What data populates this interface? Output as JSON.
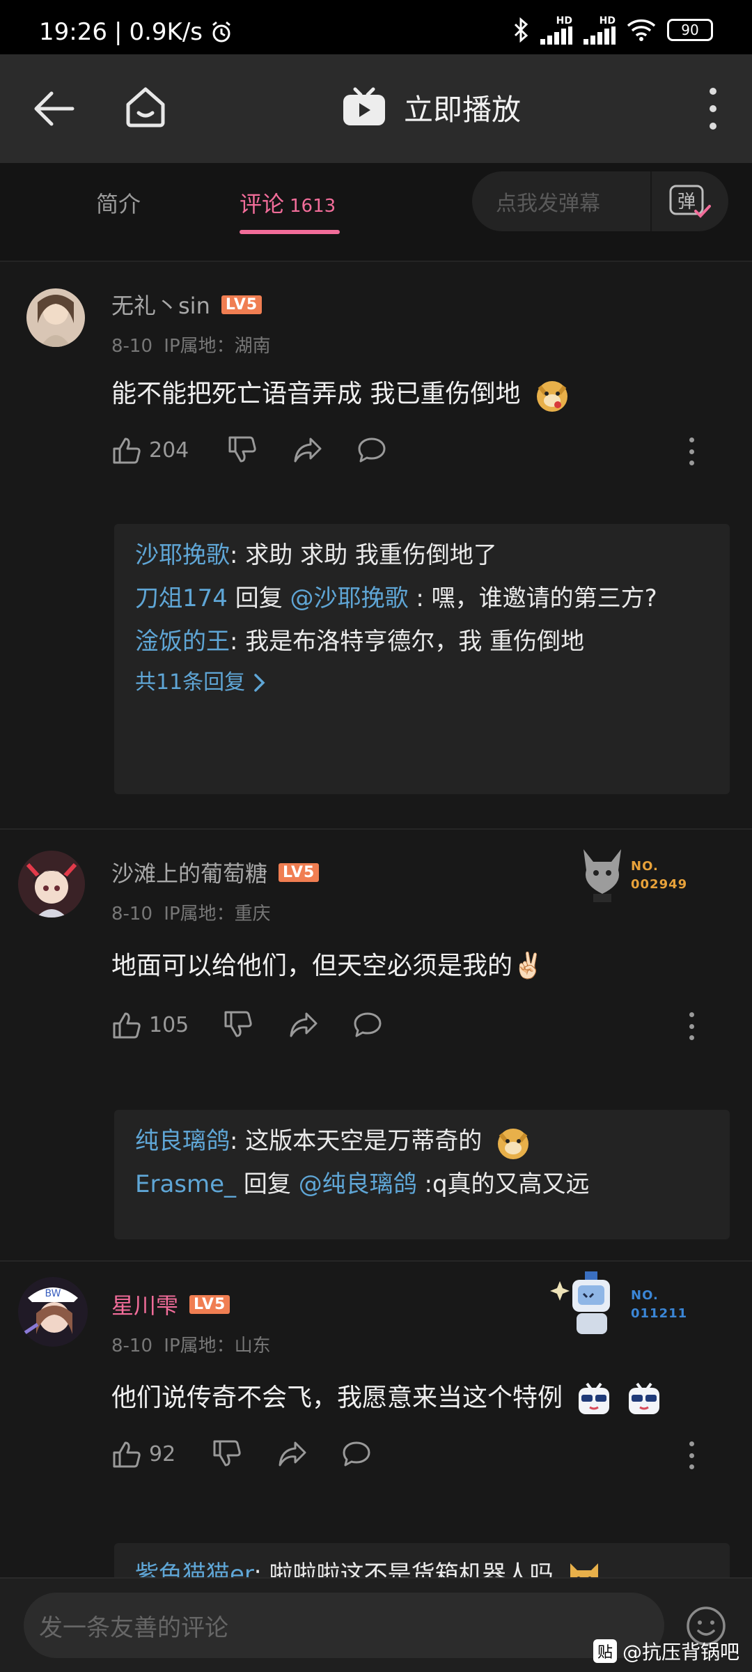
{
  "status_bar": {
    "time": "19:26",
    "speed": "0.9K/s",
    "battery": "90",
    "hd1": "HD",
    "hd2": "HD"
  },
  "top_bar": {
    "title": "立即播放"
  },
  "tabs": {
    "intro": "简介",
    "comments": "评论",
    "comments_count": "1613"
  },
  "danmaku": {
    "placeholder": "点我发弹幕",
    "icon_text": "弹"
  },
  "comments": [
    {
      "user": "无礼丶sin",
      "level": "LV5",
      "date": "8-10",
      "ip": "IP属地：湖南",
      "text": "能不能把死亡语音弄成 我已重伤倒地",
      "likes": "204",
      "replies": [
        {
          "user": "沙耶挽歌",
          "text": ": 求助 求助 我重伤倒地了"
        },
        {
          "user": "刀俎174",
          "reply_word": " 回复 ",
          "at": "@沙耶挽歌",
          "text": " : 嘿，谁邀请的第三方?"
        },
        {
          "user": "淦饭的王",
          "text": ": 我是布洛特亨德尔，我 重伤倒地"
        }
      ],
      "total": "共11条回复"
    },
    {
      "user": "沙滩上的葡萄糖",
      "level": "LV5",
      "date": "8-10",
      "ip": "IP属地：重庆",
      "text": "地面可以给他们，但天空必须是我的✌🏻",
      "likes": "105",
      "medal_no": "NO.",
      "medal_num": "002949",
      "replies": [
        {
          "user": "纯良璃鸽",
          "text": ": 这版本天空是万蒂奇的"
        },
        {
          "user": "Erasme_",
          "reply_word": " 回复 ",
          "at": "@纯良璃鸽",
          "text": " :q真的又高又远"
        }
      ]
    },
    {
      "user": "星川雫",
      "level": "LV5",
      "date": "8-10",
      "ip": "IP属地：山东",
      "text": "他们说传奇不会飞，我愿意来当这个特例",
      "likes": "92",
      "medal_no": "NO.",
      "medal_num": "011211",
      "replies": [
        {
          "user": "紫色猫猫er",
          "text": ": 啦啦啦这不是货箱机器人吗"
        }
      ]
    }
  ],
  "input": {
    "placeholder": "发一条友善的评论"
  },
  "watermark": {
    "logo": "贴",
    "text": "@抗压背锅吧"
  },
  "colors": {
    "accent_pink": "#f26d9a",
    "link_blue": "#5fa6d6",
    "level_orange": "#f07e52"
  }
}
